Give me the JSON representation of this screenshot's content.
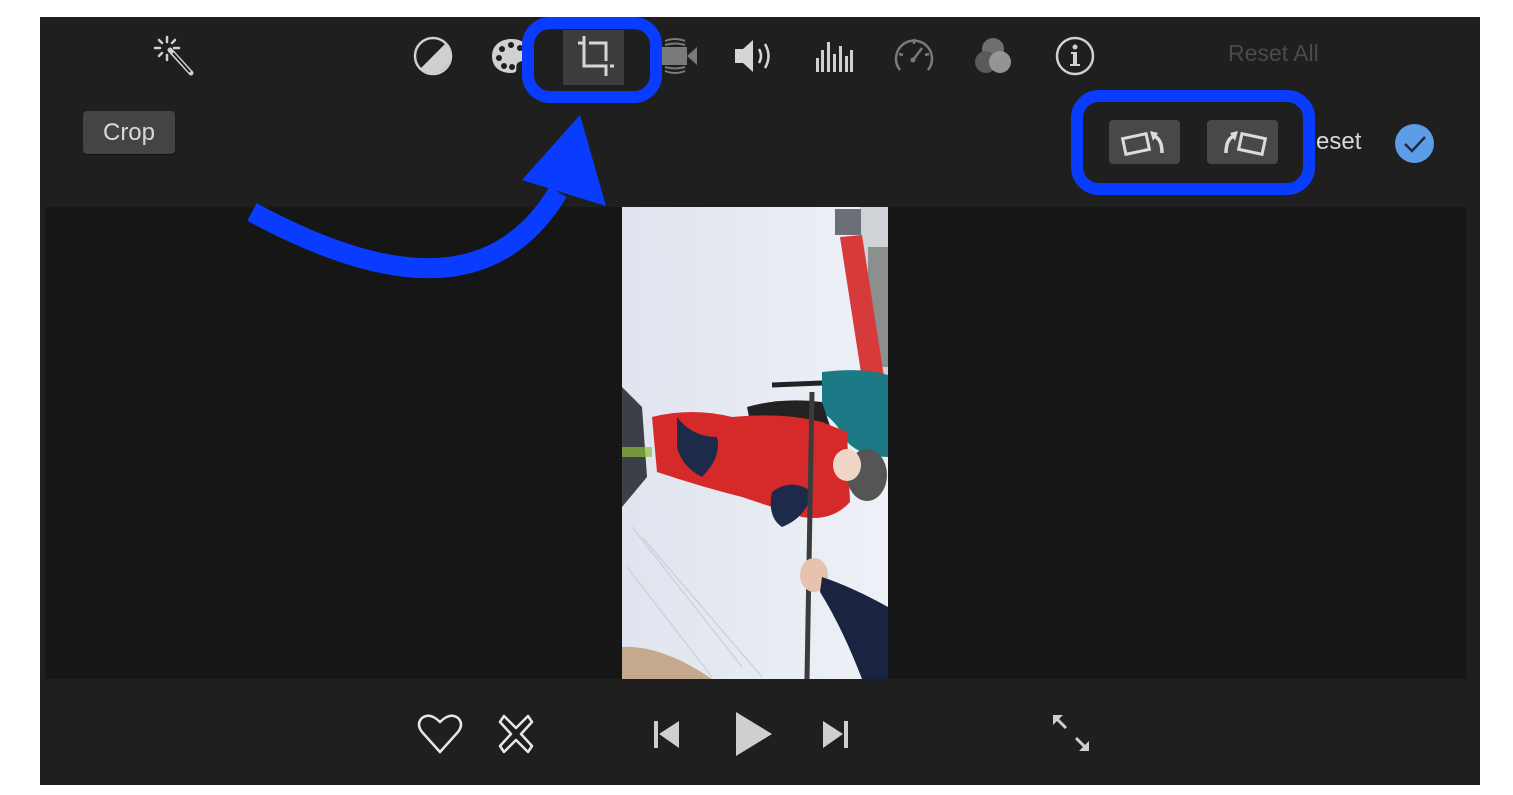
{
  "toolbar": {
    "tools": [
      {
        "id": "enhance",
        "icon": "magic-wand-icon"
      },
      {
        "id": "color-balance",
        "icon": "color-balance-icon"
      },
      {
        "id": "color-correction",
        "icon": "palette-icon"
      },
      {
        "id": "crop",
        "icon": "crop-icon",
        "active": true
      },
      {
        "id": "stabilization",
        "icon": "video-camera-icon"
      },
      {
        "id": "volume",
        "icon": "speaker-icon"
      },
      {
        "id": "noise-reduction",
        "icon": "equalizer-icon"
      },
      {
        "id": "speed",
        "icon": "speedometer-icon"
      },
      {
        "id": "clip-filter",
        "icon": "filter-circles-icon"
      },
      {
        "id": "clip-info",
        "icon": "info-icon"
      }
    ],
    "reset_all_label": "Reset All"
  },
  "crop_bar": {
    "mode_label": "Crop",
    "rotate_left_icon": "rotate-counterclockwise-icon",
    "rotate_right_icon": "rotate-clockwise-icon",
    "reset_label": "eset",
    "done_icon": "checkmark-icon"
  },
  "playback": {
    "favorite_icon": "heart-icon",
    "reject_icon": "reject-x-icon",
    "previous_icon": "skip-back-icon",
    "play_icon": "play-icon",
    "next_icon": "skip-forward-icon",
    "fullscreen_icon": "expand-arrows-icon"
  },
  "annotations": {
    "highlight_color": "#0a3cff",
    "checkmark_color": "#5b9de6"
  },
  "preview": {
    "content": "vertical video frame of children skiing on a snowy slope, rotated sideways"
  }
}
